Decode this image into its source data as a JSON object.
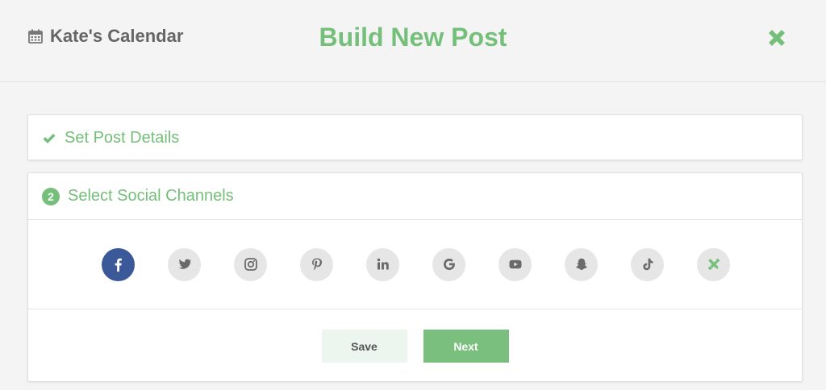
{
  "header": {
    "calendar_name": "Kate's Calendar",
    "calendar_icon": "calendar-icon",
    "title": "Build New Post",
    "close_icon": "close-icon"
  },
  "steps": [
    {
      "label": "Set Post Details",
      "status": "complete",
      "icon": "check-icon"
    },
    {
      "label": "Select Social Channels",
      "number": "2",
      "status": "active"
    }
  ],
  "channels": [
    {
      "name": "facebook",
      "icon": "facebook-icon",
      "selected": true
    },
    {
      "name": "twitter",
      "icon": "twitter-icon",
      "selected": false
    },
    {
      "name": "instagram",
      "icon": "instagram-icon",
      "selected": false
    },
    {
      "name": "pinterest",
      "icon": "pinterest-icon",
      "selected": false
    },
    {
      "name": "linkedin",
      "icon": "linkedin-icon",
      "selected": false
    },
    {
      "name": "google",
      "icon": "google-icon",
      "selected": false
    },
    {
      "name": "youtube",
      "icon": "youtube-icon",
      "selected": false
    },
    {
      "name": "snapchat",
      "icon": "snapchat-icon",
      "selected": false
    },
    {
      "name": "tiktok",
      "icon": "tiktok-icon",
      "selected": false
    },
    {
      "name": "custom",
      "icon": "pencil-ruler-icon",
      "selected": false
    }
  ],
  "actions": {
    "save_label": "Save",
    "next_label": "Next"
  },
  "colors": {
    "accent": "#74bf79",
    "facebook": "#3b5998",
    "background": "#f4f4f4",
    "icon_gray": "#6b6b6b"
  }
}
